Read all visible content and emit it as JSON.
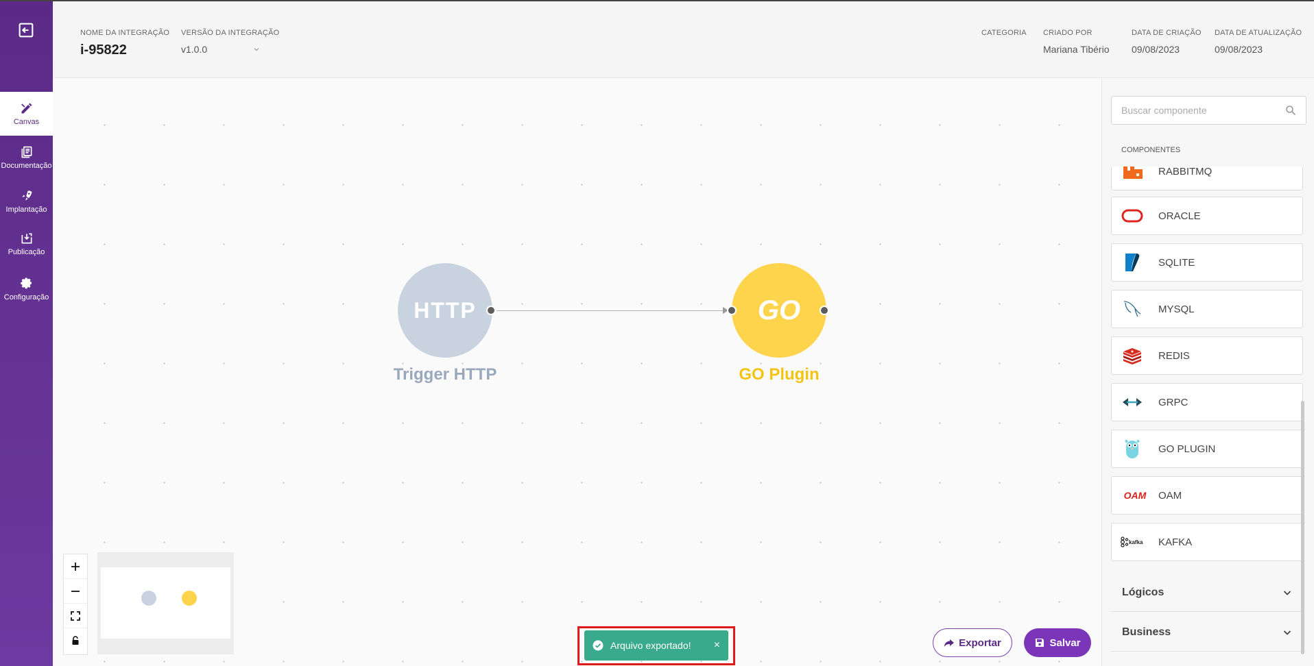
{
  "sidebar": {
    "items": [
      {
        "label": "Canvas"
      },
      {
        "label": "Documentação"
      },
      {
        "label": "Implantação"
      },
      {
        "label": "Publicação"
      },
      {
        "label": "Configuração"
      }
    ]
  },
  "header": {
    "integration_name_label": "NOME DA INTEGRAÇÃO",
    "integration_name": "i-95822",
    "version_label": "VERSÃO DA INTEGRAÇÃO",
    "version": "v1.0.0",
    "category_label": "CATEGORIA",
    "created_by_label": "CRIADO POR",
    "created_by": "Mariana Tibério",
    "created_at_label": "DATA DE CRIAÇÃO",
    "created_at": "09/08/2023",
    "updated_at_label": "DATA DE ATUALIZAÇÃO",
    "updated_at": "09/08/2023"
  },
  "canvas": {
    "nodes": [
      {
        "id": "trigger-http",
        "icon_text": "HTTP",
        "label": "Trigger HTTP",
        "color": "#c9d3e0",
        "label_color": "#9aa8bd"
      },
      {
        "id": "go-plugin",
        "icon_text": "GO",
        "label": "GO Plugin",
        "color": "#fdd44b",
        "label_color": "#f4c414"
      }
    ]
  },
  "panel": {
    "search_placeholder": "Buscar componente",
    "components_title": "COMPONENTES",
    "components": [
      {
        "name": "RABBITMQ",
        "icon": "rabbitmq-icon"
      },
      {
        "name": "ORACLE",
        "icon": "oracle-icon"
      },
      {
        "name": "SQLITE",
        "icon": "sqlite-icon"
      },
      {
        "name": "MYSQL",
        "icon": "mysql-icon"
      },
      {
        "name": "REDIS",
        "icon": "redis-icon"
      },
      {
        "name": "GRPC",
        "icon": "grpc-icon"
      },
      {
        "name": "GO PLUGIN",
        "icon": "gopher-icon"
      },
      {
        "name": "OAM",
        "icon": "oam-icon"
      },
      {
        "name": "KAFKA",
        "icon": "kafka-icon"
      }
    ],
    "sections": [
      {
        "title": "Lógicos"
      },
      {
        "title": "Business"
      }
    ]
  },
  "actions": {
    "export_label": "Exportar",
    "save_label": "Salvar"
  },
  "toast": {
    "message": "Arquivo exportado!",
    "close": "×"
  },
  "colors": {
    "brand": "#6c3aa0",
    "toast": "#3aaa8c"
  }
}
